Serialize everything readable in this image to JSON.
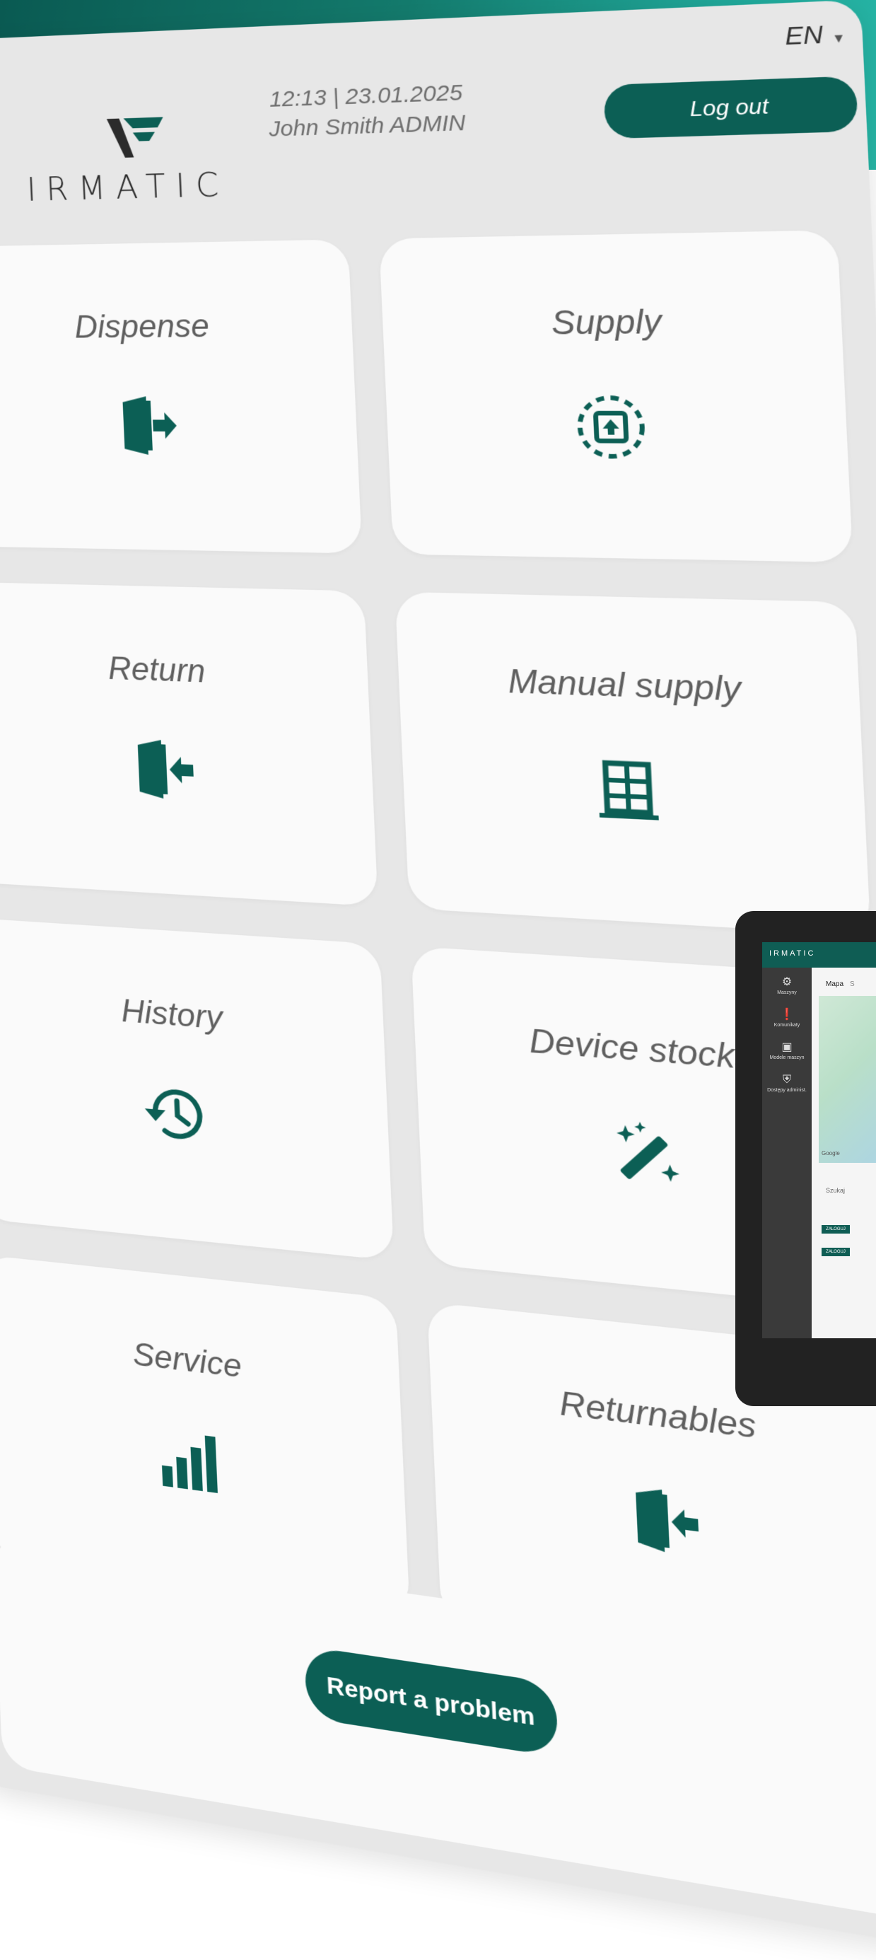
{
  "header": {
    "brand": "IRMATIC",
    "time_date": "12:13 | 23.01.2025",
    "user": "John Smith ADMIN",
    "language": "EN",
    "logout_label": "Log out"
  },
  "tiles": [
    {
      "label": "Dispense",
      "icon": "dispense-icon"
    },
    {
      "label": "Supply",
      "icon": "supply-icon"
    },
    {
      "label": "Return",
      "icon": "return-icon"
    },
    {
      "label": "Manual supply",
      "icon": "manual-supply-icon"
    },
    {
      "label": "History",
      "icon": "history-icon"
    },
    {
      "label": "Device stocks",
      "icon": "magic-wand-icon"
    },
    {
      "label": "Service",
      "icon": "signal-bars-icon"
    },
    {
      "label": "Returnables",
      "icon": "returnables-icon"
    }
  ],
  "footer": {
    "report_label": "Report a problem"
  },
  "tablet": {
    "brand": "IRMATIC",
    "tab_map": "Mapa",
    "tab_other": "S",
    "side_items": [
      "Maszyny",
      "Komunikaty",
      "Modele maszyn",
      "Dostępy administ."
    ],
    "search_placeholder": "Szukaj",
    "row_button": "ZALOGUJ",
    "map_credit": "Google"
  },
  "colors": {
    "accent": "#0c5f55",
    "tile_bg": "#fafafa",
    "panel_bg": "#e7e7e7"
  }
}
